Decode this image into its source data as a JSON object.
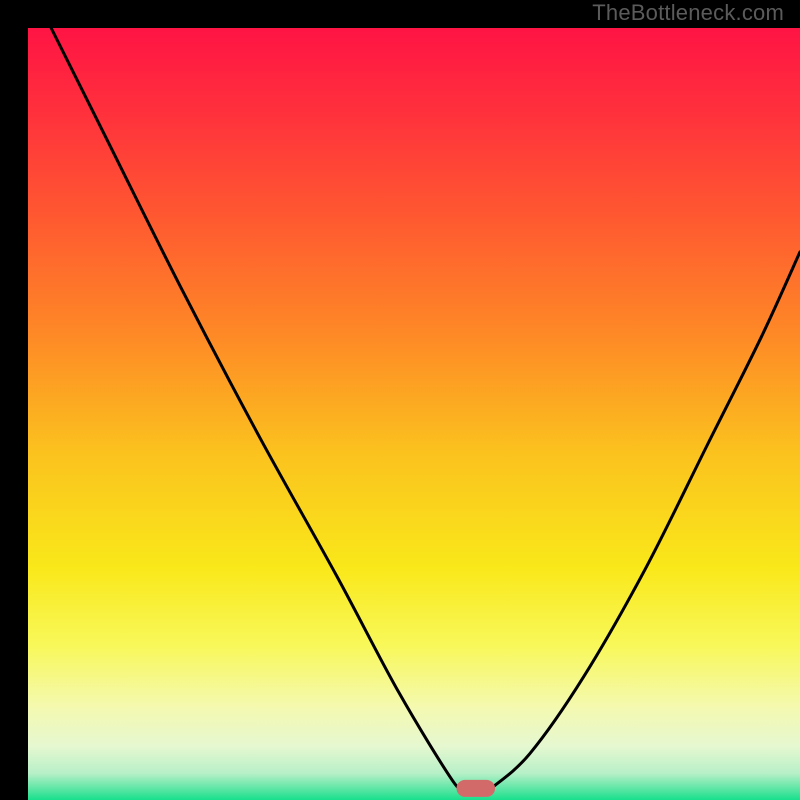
{
  "watermark": "TheBottleneck.com",
  "chart_data": {
    "type": "line",
    "title": "",
    "xlabel": "",
    "ylabel": "",
    "xlim": [
      0,
      100
    ],
    "ylim": [
      0,
      100
    ],
    "curves": [
      {
        "name": "left",
        "x": [
          3,
          10,
          20,
          30,
          40,
          48,
          55,
          56.5
        ],
        "y": [
          100,
          86,
          66,
          47,
          29,
          14,
          2.5,
          1.5
        ]
      },
      {
        "name": "right",
        "x": [
          60,
          65,
          72,
          80,
          88,
          95,
          100
        ],
        "y": [
          1.5,
          6,
          16,
          30,
          46,
          60,
          71
        ]
      }
    ],
    "marker": {
      "x": 58,
      "y": 1.5,
      "w": 5,
      "h": 2.2,
      "color": "#D36A6A"
    },
    "gradient_stops": [
      {
        "offset": 0.0,
        "color": "#FF1444"
      },
      {
        "offset": 0.1,
        "color": "#FF2E3D"
      },
      {
        "offset": 0.25,
        "color": "#FF5A30"
      },
      {
        "offset": 0.4,
        "color": "#FE8A26"
      },
      {
        "offset": 0.55,
        "color": "#FBC21E"
      },
      {
        "offset": 0.7,
        "color": "#F9E81A"
      },
      {
        "offset": 0.8,
        "color": "#F8F85A"
      },
      {
        "offset": 0.88,
        "color": "#F4F9B0"
      },
      {
        "offset": 0.93,
        "color": "#E6F8D0"
      },
      {
        "offset": 0.965,
        "color": "#B8F0C8"
      },
      {
        "offset": 0.985,
        "color": "#5FE6A6"
      },
      {
        "offset": 1.0,
        "color": "#18E08C"
      }
    ]
  }
}
